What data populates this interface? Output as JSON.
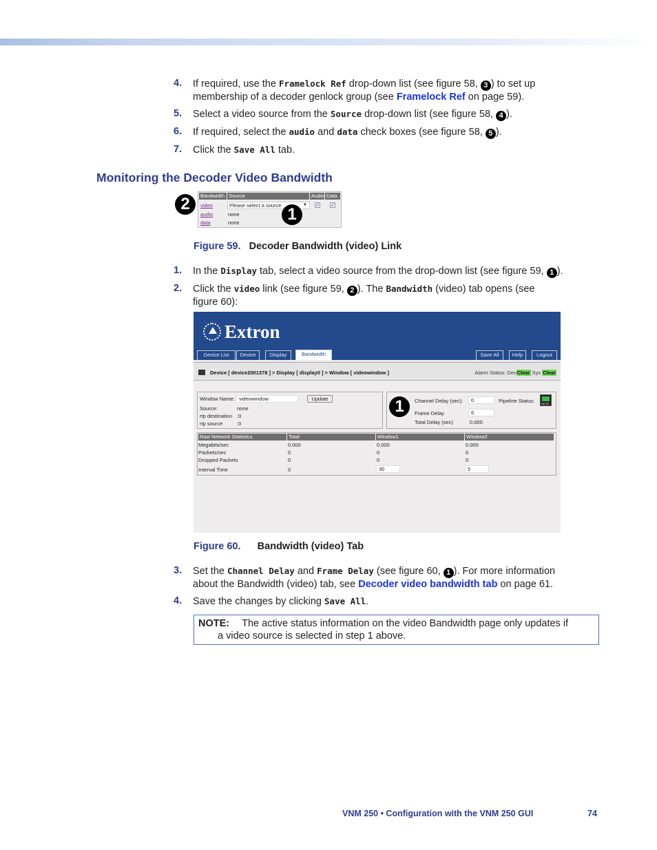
{
  "steps_top": [
    {
      "num": "4.",
      "parts": [
        "If required, use the ",
        "Framelock Ref",
        " drop-down list (see figure 58, ",
        "3",
        ") to set up"
      ],
      "line2_parts": [
        "membership of a decoder genlock group (see ",
        "Framelock Ref",
        " on page 59)."
      ]
    },
    {
      "num": "5.",
      "parts": [
        "Select a video source from the ",
        "Source",
        " drop-down list (see figure 58, ",
        "4",
        ")."
      ]
    },
    {
      "num": "6.",
      "parts": [
        "If required, select the ",
        "audio",
        " and ",
        "data",
        " check boxes (see figure 58, ",
        "5",
        ")."
      ]
    },
    {
      "num": "7.",
      "parts": [
        "Click the ",
        "Save All",
        " tab."
      ]
    }
  ],
  "section_heading": "Monitoring the Decoder Video Bandwidth",
  "figure59": {
    "headers": [
      "Bandwidth",
      "Source",
      "Audio",
      "Data"
    ],
    "rows": [
      {
        "link": "video",
        "value": "Please select a source"
      },
      {
        "link": "audio",
        "value": "none"
      },
      {
        "link": "data",
        "value": "none"
      }
    ],
    "callouts": [
      "2",
      "1"
    ],
    "caption_number": "Figure 59.",
    "caption_title": "Decoder Bandwidth (video) Link"
  },
  "steps_mid": [
    {
      "num": "1.",
      "parts": [
        "In the ",
        "Display",
        " tab, select a video source from the drop-down list (see figure 59, ",
        "1",
        ")."
      ]
    },
    {
      "num": "2.",
      "parts": [
        "Click the ",
        "video",
        " link (see figure 59, ",
        "2",
        "). The ",
        "Bandwidth",
        " (video) tab opens (see"
      ],
      "line2": "figure 60):"
    }
  ],
  "figure60": {
    "brand": "Extron",
    "tabs_left": [
      "Device List",
      "Device",
      "Display",
      "Bandwidth"
    ],
    "active_tab": "Bandwidth",
    "tabs_right": [
      "Save All",
      "Help",
      "Logout"
    ],
    "breadcrumb": "Device [ device2001378 ]  >  Display [ display0 ]  >  Window [ videowindow ]",
    "alarm_label": "Alarm Status:",
    "alarm_dev_label": "Dev",
    "alarm_dev_value": "Clear",
    "alarm_sys_label": "Sys",
    "alarm_sys_value": "Clear",
    "window_name_label": "Window Name:",
    "window_name_value": "videowindow",
    "update_button": "Update",
    "source_label": "Source:",
    "source_value": "none",
    "rtp_dest_label": "rtp destination",
    "rtp_dest_value": ":0",
    "rtp_src_label": "rtp source",
    "rtp_src_value": ":0",
    "channel_delay_label": "Channel Delay (sec):",
    "channel_delay_value": "0",
    "frame_delay_label": "Frame Delay",
    "frame_delay_value": "6",
    "total_delay_label": "Total Delay (sec)",
    "total_delay_value": "0.000",
    "pipeline_label": "Pipeline Status:",
    "callout": "1",
    "stats_headers": [
      "Raw Network Statistics",
      "Total",
      "Window1",
      "Window2"
    ],
    "stats_rows": [
      {
        "label": "Megabits/sec",
        "total": "0.000",
        "w1": "0.000",
        "w2": "0.000"
      },
      {
        "label": "Packets/sec",
        "total": "0",
        "w1": "0",
        "w2": "0"
      },
      {
        "label": "Dropped Packets",
        "total": "0",
        "w1": "0",
        "w2": "0"
      },
      {
        "label": "Interval Time",
        "total": "0",
        "w1": "30",
        "w2": "5"
      }
    ],
    "caption_number": "Figure 60.",
    "caption_title": "Bandwidth (video) Tab"
  },
  "steps_bottom": [
    {
      "num": "3.",
      "parts": [
        "Set the ",
        "Channel Delay",
        " and ",
        "Frame Delay",
        " (see figure 60, ",
        "1",
        "). For more information"
      ],
      "line2_parts": [
        "about the Bandwidth (video) tab, see ",
        "Decoder video bandwidth tab",
        " on page 61."
      ]
    },
    {
      "num": "4.",
      "parts": [
        "Save the changes by clicking ",
        "Save All",
        "."
      ]
    }
  ],
  "note": {
    "label": "NOTE:",
    "line1": "The active status information on the video Bandwidth page only updates if",
    "line2": "a video source is selected in step 1 above."
  },
  "footer": {
    "title": "VNM 250 • Configuration with the VNM 250 GUI",
    "page": "74"
  }
}
